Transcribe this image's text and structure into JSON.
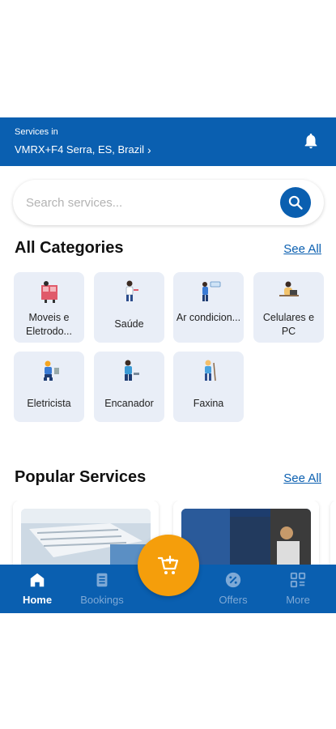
{
  "header": {
    "services_in_label": "Services in",
    "location": "VMRX+F4 Serra, ES, Brazil",
    "chevron_icon": "chevron-right-icon",
    "bell_icon": "bell-icon"
  },
  "search": {
    "placeholder": "Search services...",
    "value": "",
    "icon": "search-icon"
  },
  "categories_section": {
    "title": "All Categories",
    "see_all": "See All",
    "items": [
      {
        "label": "Moveis e Eletrodo...",
        "icon": "furniture-icon"
      },
      {
        "label": "Saúde",
        "icon": "health-icon"
      },
      {
        "label": "Ar condicion...",
        "icon": "air-conditioning-icon"
      },
      {
        "label": "Celulares e PC",
        "icon": "phone-pc-repair-icon"
      },
      {
        "label": "Eletricista",
        "icon": "electrician-icon"
      },
      {
        "label": "Encanador",
        "icon": "plumber-icon"
      },
      {
        "label": "Faxina",
        "icon": "cleaning-icon"
      }
    ]
  },
  "popular_section": {
    "title": "Popular Services",
    "see_all": "See All"
  },
  "bottom_nav": {
    "items": [
      {
        "label": "Home",
        "icon": "home-icon",
        "active": true
      },
      {
        "label": "Bookings",
        "icon": "bookings-icon",
        "active": false
      },
      {
        "label": "Offers",
        "icon": "offers-icon",
        "active": false
      },
      {
        "label": "More",
        "icon": "more-grid-icon",
        "active": false
      }
    ],
    "fab_icon": "cart-add-icon"
  },
  "colors": {
    "primary": "#0a5fb0",
    "accent": "#f59e0b",
    "category_bg": "#e9eef7"
  }
}
